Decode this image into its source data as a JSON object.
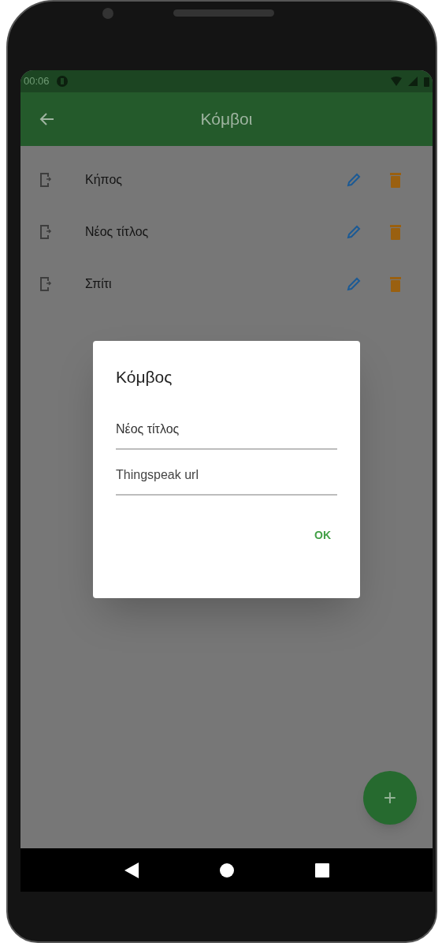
{
  "status_bar": {
    "time": "00:06"
  },
  "app_bar": {
    "title": "Κόμβοι"
  },
  "nodes": [
    {
      "name": "Κήπος"
    },
    {
      "name": "Νέος τίτλος"
    },
    {
      "name": "Σπίτι"
    }
  ],
  "dialog": {
    "title": "Κόμβος",
    "fields": [
      {
        "value": "Νέος τίτλος"
      },
      {
        "placeholder": "Thingspeak url"
      }
    ],
    "buttons": [
      "OK"
    ]
  },
  "fab": {
    "label": "+"
  }
}
